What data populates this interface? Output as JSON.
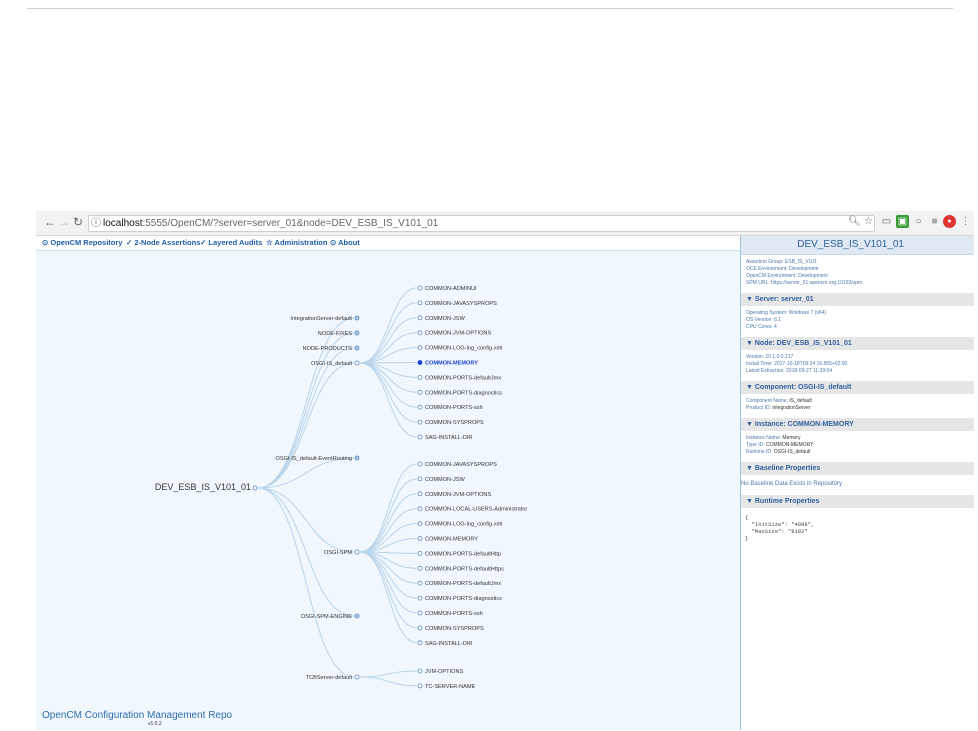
{
  "browser": {
    "url_host": "localhost",
    "url_rest": ":5555/OpenCM/?server=server_01&node=DEV_ESB_IS_V101_01"
  },
  "menu": [
    {
      "icon": "⊙",
      "label": "OpenCM Repository"
    },
    {
      "icon": "✓",
      "label": "2-Node Assertions"
    },
    {
      "icon": "✓",
      "label": "Layered Audits"
    },
    {
      "icon": "☆",
      "label": "Administration"
    },
    {
      "icon": "⊙",
      "label": "About"
    }
  ],
  "tree": {
    "root": "DEV_ESB_IS_V101_01",
    "components": [
      {
        "label": "IntegrationServer-default",
        "expanded": false,
        "children": []
      },
      {
        "label": "NODE-FIXES",
        "expanded": false,
        "children": []
      },
      {
        "label": "NODE-PRODUCTS",
        "expanded": false,
        "children": []
      },
      {
        "label": "OSGI-IS_default",
        "expanded": true,
        "children": [
          "COMMON-ADMINUI",
          "COMMON-JAVASYSPROPS",
          "COMMON-JSW",
          "COMMON-JVM-OPTIONS",
          "COMMON-LOG-log_config.xml",
          "COMMON-MEMORY",
          "COMMON-PORTS-defaultJmx",
          "COMMON-PORTS-diagnostics",
          "COMMON-PORTS-ssh",
          "COMMON-SYSPROPS",
          "SAG-INSTALL-DIR"
        ]
      },
      {
        "label": "OSGI-IS_default-EventRouting",
        "expanded": false,
        "children": []
      },
      {
        "label": "OSGI-SPM",
        "expanded": true,
        "children": [
          "COMMON-JAVASYSPROPS",
          "COMMON-JSW",
          "COMMON-JVM-OPTIONS",
          "COMMON-LOCAL-USERS-Administrator",
          "COMMON-LOG-log_config.xml",
          "COMMON-MEMORY",
          "COMMON-PORTS-defaultHttp",
          "COMMON-PORTS-defaultHttps",
          "COMMON-PORTS-defaultJmx",
          "COMMON-PORTS-diagnostics",
          "COMMON-PORTS-ssh",
          "COMMON-SYSPROPS",
          "SAG-INSTALL-DIR"
        ]
      },
      {
        "label": "OSGI-SPM-ENGINE",
        "expanded": false,
        "children": []
      },
      {
        "label": "TCBServer-default",
        "expanded": true,
        "children": [
          "JVM-OPTIONS",
          "TC-SERVER-NAME"
        ]
      }
    ],
    "selected": "COMMON-MEMORY"
  },
  "footer": {
    "title": "OpenCM Configuration Management Repo",
    "version": "v1.0.2"
  },
  "details": {
    "header": "DEV_ESB_IS_V101_01",
    "top_lines": [
      "Assertion Group: ESB_IS_V101",
      "OCE Environment: Development",
      "OpenCM Environment: Development",
      "SPM URL: https://server_01.opencm.org:10193/spm"
    ],
    "sections": [
      {
        "title": "▼ Server: server_01",
        "lines": [
          {
            "label": "Operating System: Windows 7 (x64)",
            "value": ""
          },
          {
            "label": "OS Version: 6.1",
            "value": ""
          },
          {
            "label": "CPU Cores: 4",
            "value": ""
          }
        ]
      },
      {
        "title": "▼ Node: DEV_ESB_IS_V101_01",
        "lines": [
          {
            "label": "Version: 10.1.0.0.217",
            "value": ""
          },
          {
            "label": "Install Time: 2017-10-18T09:24:16.855+02:00",
            "value": ""
          },
          {
            "label": "Latest Extraction: 2018-09-27 11:39:04",
            "value": ""
          }
        ]
      },
      {
        "title": "▼ Component: OSGI-IS_default",
        "lines": [
          {
            "label": "Component Name:",
            "value": "IS_default"
          },
          {
            "label": "Product ID:",
            "value": "integrationServer"
          }
        ]
      },
      {
        "title": "▼ Instance: COMMON-MEMORY",
        "lines": [
          {
            "label": "Instance Name:",
            "value": "Memory"
          },
          {
            "label": "Type ID:",
            "value": "COMMON-MEMORY"
          },
          {
            "label": "Runtime ID:",
            "value": "OSGI-IS_default"
          }
        ]
      }
    ],
    "baseline_title": "▼ Baseline Properties",
    "baseline_text": "No Baseline Data Exists in Repository",
    "runtime_title": "▼ Runtime Properties",
    "runtime_text": "{\n  \"InitSize\": \"4096\",\n  \"MaxSize\": \"8192\"\n}"
  },
  "colors": {
    "accent": "#2f5f9e",
    "link_curve": "#b9d3ea",
    "selected": "#1a3fd1"
  }
}
